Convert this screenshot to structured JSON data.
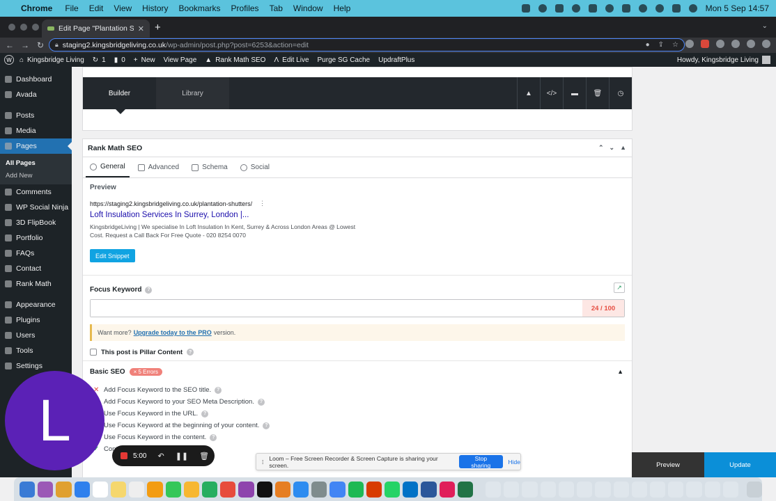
{
  "mac_menubar": {
    "app_name": "Chrome",
    "menus": [
      "File",
      "Edit",
      "View",
      "History",
      "Bookmarks",
      "Profiles",
      "Tab",
      "Window",
      "Help"
    ],
    "clock": "Mon 5 Sep  14:57"
  },
  "browser": {
    "tab_title": "Edit Page \"Plantation Shutters",
    "url_host": "staging2.kingsbridgeliving.co.uk",
    "url_path": "/wp-admin/post.php?post=6253&action=edit"
  },
  "adminbar": {
    "site": "Kingsbridge Living",
    "updates": "1",
    "comments": "0",
    "new": "New",
    "view_page": "View Page",
    "rank_math": "Rank Math SEO",
    "edit_live": "Edit Live",
    "purge": "Purge SG Cache",
    "updraft": "UpdraftPlus",
    "howdy": "Howdy, Kingsbridge Living"
  },
  "sidebar": {
    "items": [
      "Dashboard",
      "Avada",
      "Posts",
      "Media",
      "Pages",
      "Comments",
      "WP Social Ninja",
      "3D FlipBook",
      "Portfolio",
      "FAQs",
      "Contact",
      "Rank Math",
      "Appearance",
      "Plugins",
      "Users",
      "Tools",
      "Settings"
    ],
    "submenu": [
      "All Pages",
      "Add New"
    ]
  },
  "builder": {
    "tab_builder": "Builder",
    "tab_library": "Library"
  },
  "rankmath": {
    "title": "Rank Math SEO",
    "tabs": [
      "General",
      "Advanced",
      "Schema",
      "Social"
    ],
    "preview_heading": "Preview",
    "preview_url": "https://staging2.kingsbridgeliving.co.uk/plantation-shutters/",
    "preview_title": "Loft Insulation Services In Surrey, London |...",
    "preview_desc": "KingsbridgeLiving | We specialise In Loft Insulation In Kent, Surrey & Across London Areas @ Lowest Cost. Request a Call Back For Free Quote - 020 8254 0070",
    "edit_snippet": "Edit Snippet",
    "focus_label": "Focus Keyword",
    "focus_value": "",
    "score": "24 / 100",
    "pro_prefix": "Want more?",
    "pro_link": "Upgrade today to the PRO",
    "pro_suffix": "version.",
    "pillar": "This post is Pillar Content",
    "basic_seo": "Basic SEO",
    "errors": "× 5 Errors",
    "checks": [
      "Add Focus Keyword to the SEO title.",
      "Add Focus Keyword to your SEO Meta Description.",
      "Use Focus Keyword in the URL.",
      "Use Focus Keyword at the beginning of your content.",
      "Use Focus Keyword in the content.",
      "Cont"
    ]
  },
  "recorder": {
    "avatar_letter": "L",
    "timer": "5:00"
  },
  "loom": {
    "message": "Loom – Free Screen Recorder & Screen Capture is sharing your screen.",
    "stop": "Stop sharing",
    "hide": "Hide"
  },
  "publish": {
    "preview": "Preview",
    "update": "Update"
  },
  "colors": {
    "wp_blue": "#2271b1",
    "wp_dark": "#1d2327",
    "score_red": "#e64e42",
    "loom_purple": "#5b21b6"
  }
}
